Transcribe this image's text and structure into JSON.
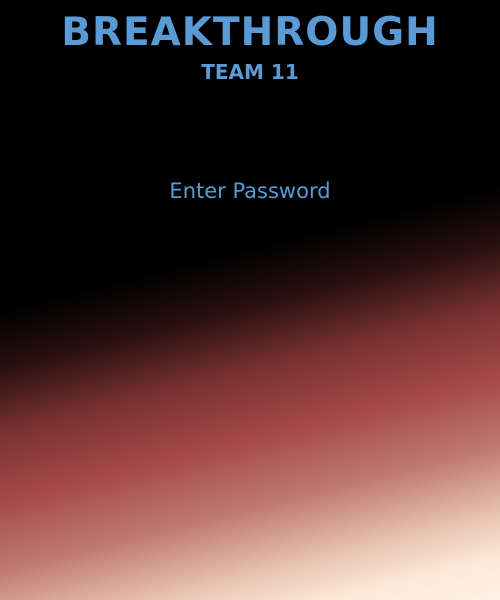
{
  "app": {
    "title": "BREAKTHROUGH",
    "subtitle": "TEAM 11"
  },
  "login": {
    "prompt": "Enter Password"
  },
  "colors": {
    "text_accent": "#5b9bd5",
    "background": "#000000",
    "glow_mid": "#a44848",
    "glow_light": "#fff1e4"
  }
}
